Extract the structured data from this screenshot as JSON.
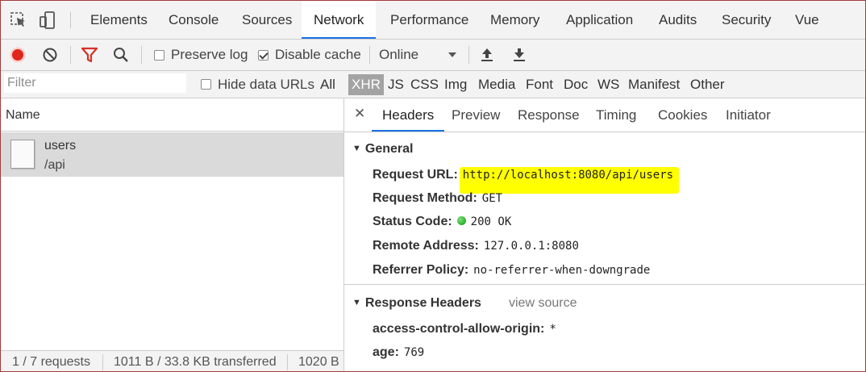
{
  "tabs": [
    "Elements",
    "Console",
    "Sources",
    "Network",
    "Performance",
    "Memory",
    "Application",
    "Audits",
    "Security",
    "Vue"
  ],
  "active_tab": "Network",
  "toolbar": {
    "preserve_log_label": "Preserve log",
    "preserve_log_checked": false,
    "disable_cache_label": "Disable cache",
    "disable_cache_checked": true,
    "throttle_value": "Online"
  },
  "filter": {
    "placeholder": "Filter",
    "hide_data_urls_label": "Hide data URLs",
    "types": [
      "All",
      "XHR",
      "JS",
      "CSS",
      "Img",
      "Media",
      "Font",
      "Doc",
      "WS",
      "Manifest",
      "Other"
    ],
    "active_type": "XHR"
  },
  "requests": {
    "header": "Name",
    "items": [
      {
        "name": "users",
        "path": "/api"
      }
    ]
  },
  "status": {
    "requests": "1 / 7 requests",
    "transferred": "1011 B / 33.8 KB transferred",
    "size": "1020 B"
  },
  "detail_tabs": [
    "Headers",
    "Preview",
    "Response",
    "Timing",
    "Cookies",
    "Initiator"
  ],
  "active_detail_tab": "Headers",
  "general": {
    "title": "General",
    "request_url_label": "Request URL:",
    "request_url": "http://localhost:8080/api/users",
    "request_method_label": "Request Method:",
    "request_method": "GET",
    "status_code_label": "Status Code:",
    "status_code": "200 OK",
    "remote_address_label": "Remote Address:",
    "remote_address": "127.0.0.1:8080",
    "referrer_policy_label": "Referrer Policy:",
    "referrer_policy": "no-referrer-when-downgrade"
  },
  "response_headers": {
    "title": "Response Headers",
    "view_source": "view source",
    "items": [
      {
        "key": "access-control-allow-origin:",
        "value": "*"
      },
      {
        "key": "age:",
        "value": "769"
      }
    ]
  },
  "colors": {
    "record": "#e0251b",
    "filter_icon": "#d93025",
    "accent": "#1a73e8",
    "highlight": "#ffff00",
    "status_ok": "#0a9b0a"
  }
}
